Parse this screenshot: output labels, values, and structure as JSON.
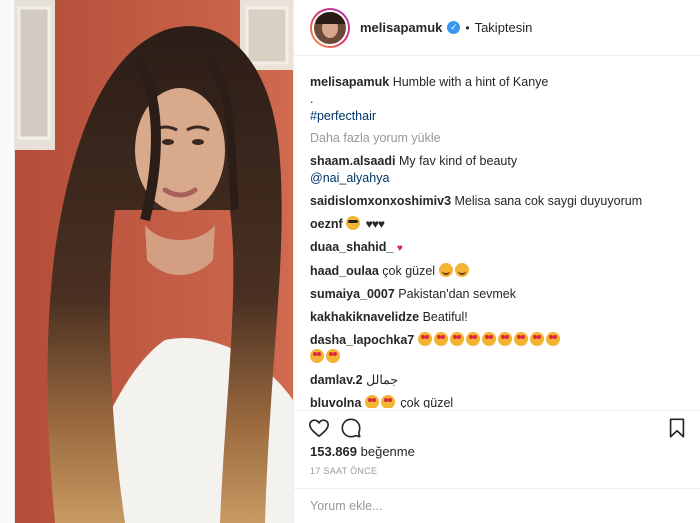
{
  "post": {
    "username": "melisapamuk",
    "verified": true,
    "follow_separator": "•",
    "follow_status": "Takiptesin",
    "caption": {
      "user": "melisapamuk",
      "text": "Humble with a hint of Kanye",
      "line2": ".",
      "hashtag": "#perfecthair"
    },
    "load_more": "Daha fazla yorum yükle",
    "comments": [
      {
        "user": "shaam.alsaadi",
        "text": "My fav kind of beauty",
        "mention": "@nai_alyahya"
      },
      {
        "user": "saidislomxonxoshimiv3",
        "text": "Melisa sana cok saygi duyuyorum"
      },
      {
        "user": "oeznf",
        "text": "♥♥♥"
      },
      {
        "user": "duaa_shahid_"
      },
      {
        "user": "haad_oulaa",
        "text": "çok güzel"
      },
      {
        "user": "sumaiya_0007",
        "text": "Pakistan'dan sevmek"
      },
      {
        "user": "kakhakiknavelidze",
        "text": "Beatiful!"
      },
      {
        "user": "dasha_lapochka7"
      },
      {
        "user": "damlav.2",
        "text": "جمالل"
      },
      {
        "user": "bluvolna",
        "text": "çok güzel"
      }
    ],
    "likes_count": "153.869",
    "likes_label": "beğenme",
    "time_ago": "17 SAAT ÖNCE",
    "comment_placeholder": "Yorum ekle..."
  },
  "icons": [
    "heart-icon",
    "comment-icon",
    "bookmark-icon",
    "verified-badge-icon"
  ],
  "colors": {
    "link": "#003569",
    "verified": "#3897f0",
    "muted": "#999999",
    "wall": "#c0573f"
  }
}
